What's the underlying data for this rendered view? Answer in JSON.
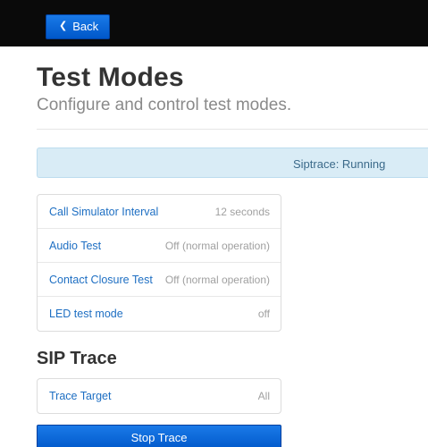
{
  "topbar": {
    "back_label": "Back",
    "back_icon": "chevron-left-icon"
  },
  "header": {
    "title": "Test Modes",
    "subtitle": "Configure and control test modes."
  },
  "status": {
    "text": "Siptrace: Running"
  },
  "settings": {
    "items": [
      {
        "label": "Call Simulator Interval",
        "value": "12 seconds"
      },
      {
        "label": "Audio Test",
        "value": "Off (normal operation)"
      },
      {
        "label": "Contact Closure Test",
        "value": "Off (normal operation)"
      },
      {
        "label": "LED test mode",
        "value": "off"
      }
    ]
  },
  "sip_trace": {
    "title": "SIP Trace",
    "items": [
      {
        "label": "Trace Target",
        "value": "All"
      }
    ],
    "stop_label": "Stop Trace"
  },
  "colors": {
    "accent": "#0a6ad8",
    "link": "#1e6fc3",
    "status_bg": "#d9ecf6"
  }
}
